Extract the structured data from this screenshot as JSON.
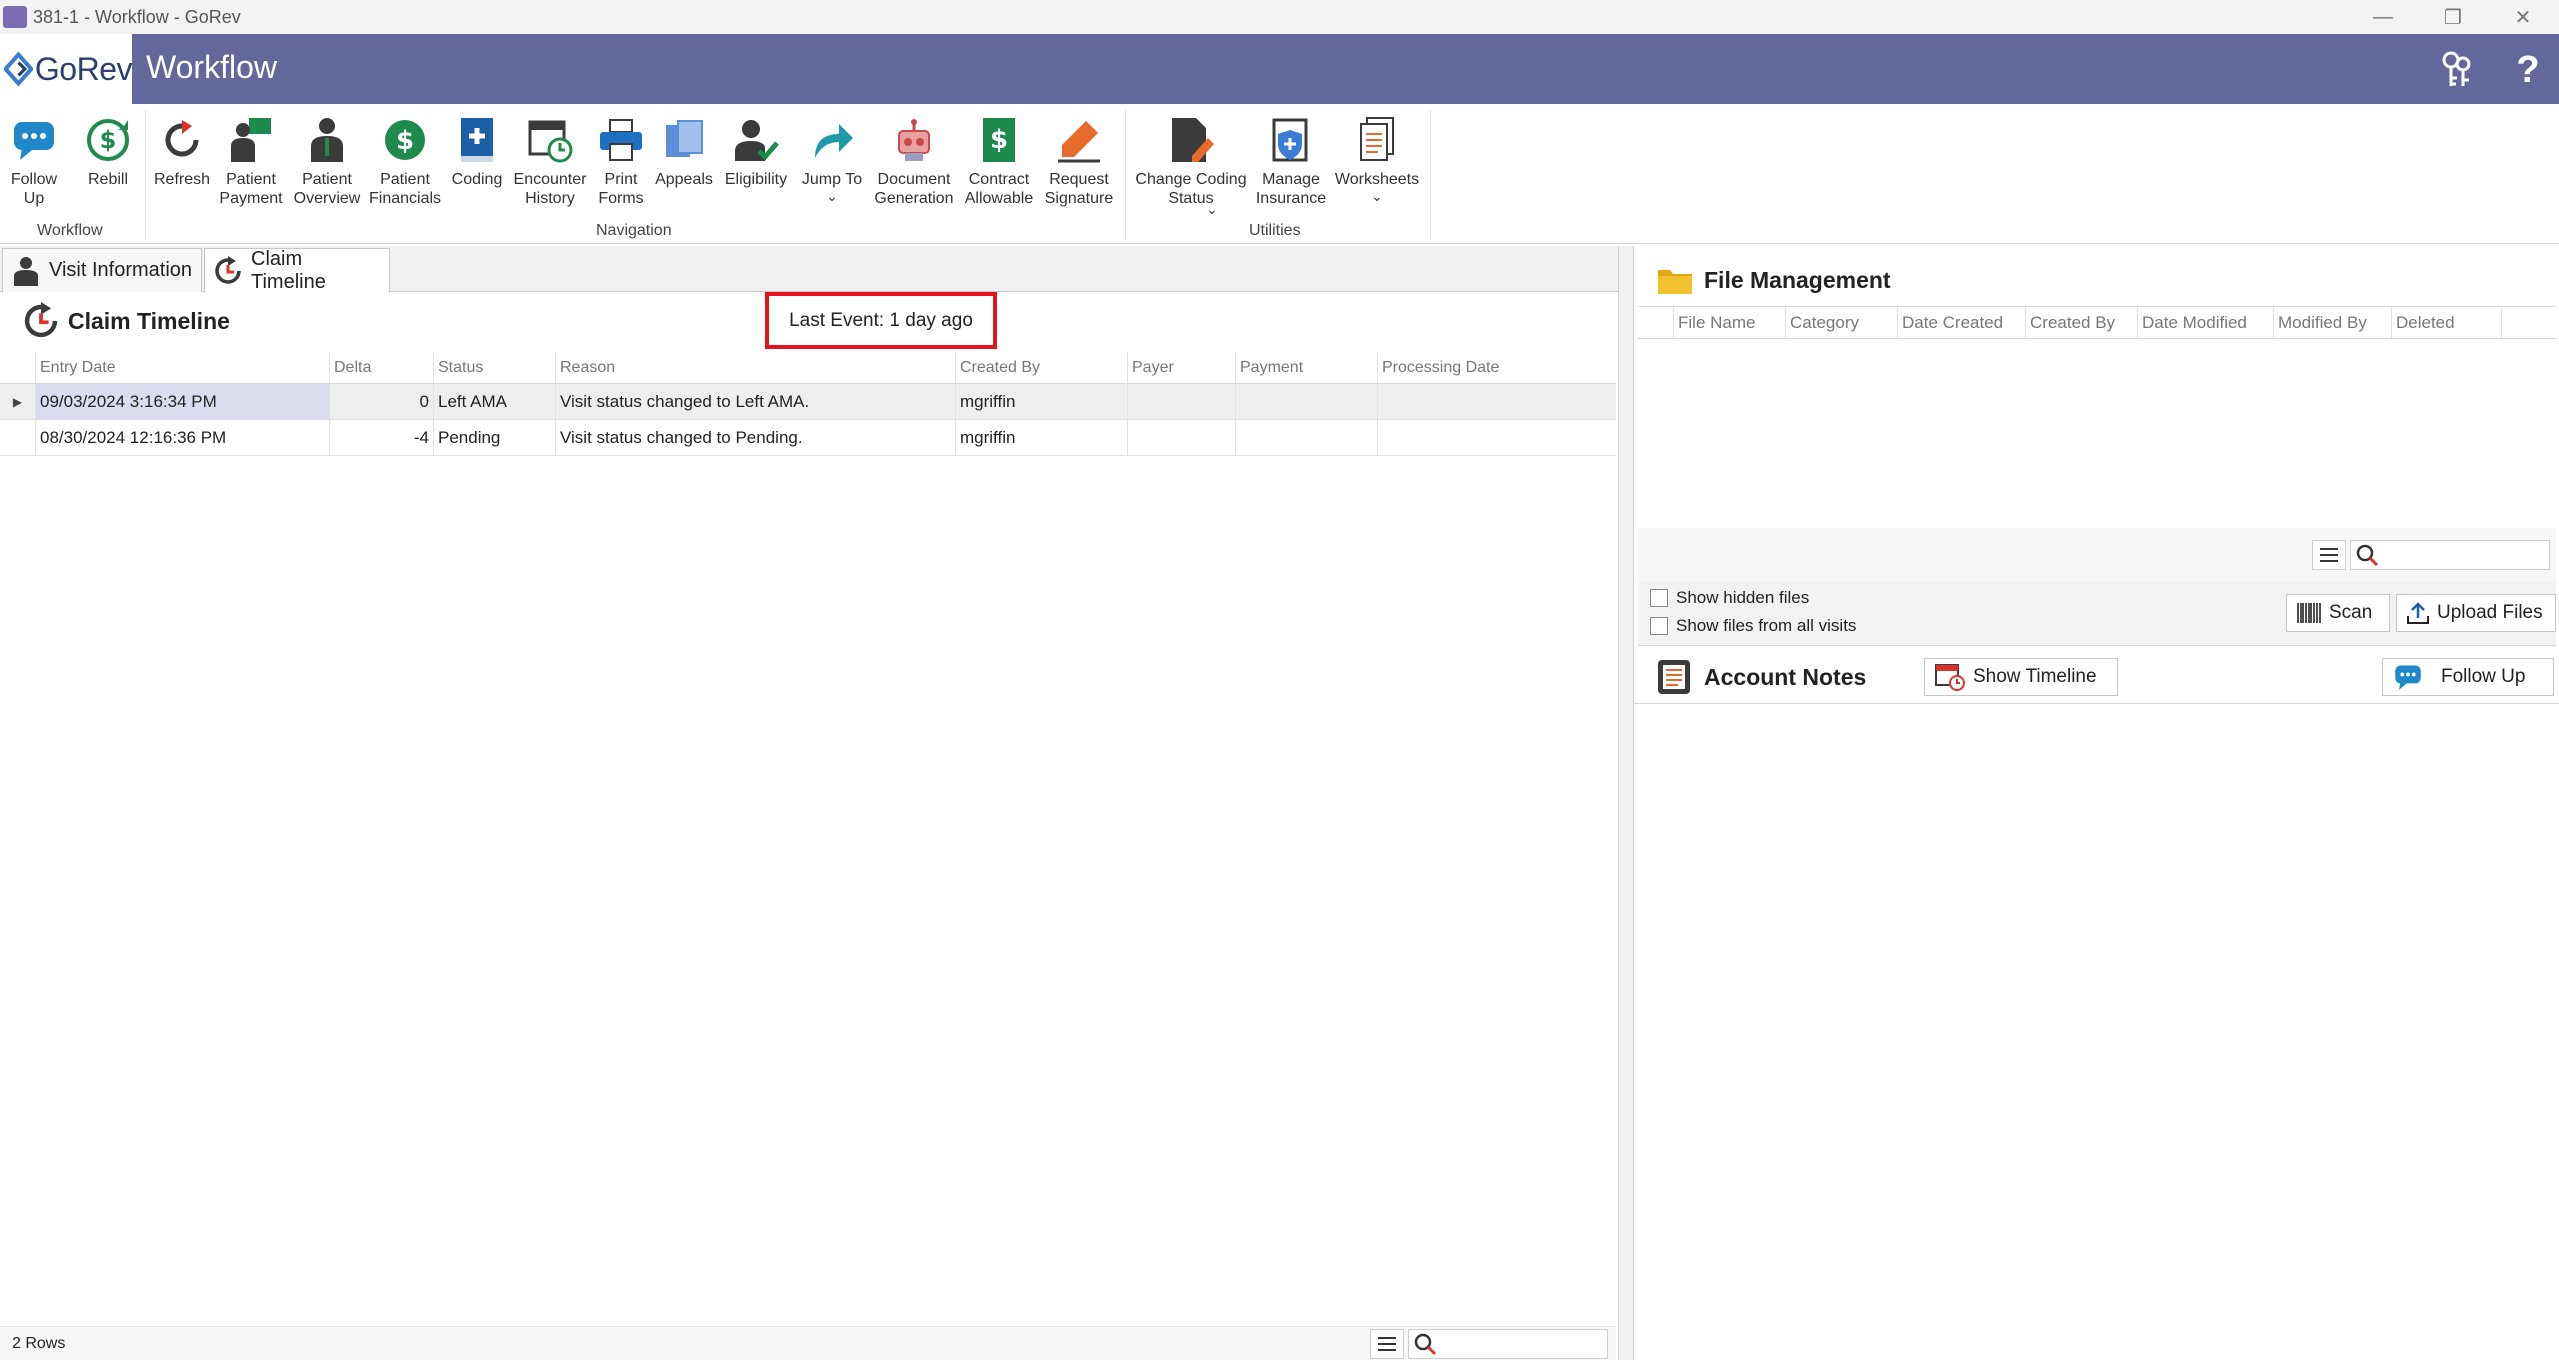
{
  "window": {
    "title": "381-1 - Workflow - GoRev",
    "controls": {
      "minimize": "—",
      "restore": "❐",
      "close": "✕"
    }
  },
  "header": {
    "logo_text": "GoRev",
    "title": "Workflow",
    "brand_color": "#64679b"
  },
  "ribbon": {
    "groups": [
      {
        "label": "Workflow"
      },
      {
        "label": "Navigation"
      },
      {
        "label": "Utilities"
      }
    ],
    "buttons": [
      {
        "label": "Follow\nUp",
        "icon": "chat-icon"
      },
      {
        "label": "Rebill",
        "icon": "rebill-dollar-icon"
      },
      {
        "label": "Refresh",
        "icon": "refresh-icon"
      },
      {
        "label": "Patient\nPayment",
        "icon": "patient-payment-icon"
      },
      {
        "label": "Patient\nOverview",
        "icon": "patient-overview-icon"
      },
      {
        "label": "Patient\nFinancials",
        "icon": "dollar-circle-icon"
      },
      {
        "label": "Coding",
        "icon": "medical-book-icon"
      },
      {
        "label": "Encounter\nHistory",
        "icon": "calendar-clock-icon"
      },
      {
        "label": "Print\nForms",
        "icon": "printer-icon"
      },
      {
        "label": "Appeals",
        "icon": "documents-icon"
      },
      {
        "label": "Eligibility",
        "icon": "user-check-icon"
      },
      {
        "label": "Jump To",
        "icon": "jump-arrow-icon"
      },
      {
        "label": "Document\nGeneration",
        "icon": "robot-icon"
      },
      {
        "label": "Contract\nAllowable",
        "icon": "dollar-document-icon"
      },
      {
        "label": "Request\nSignature",
        "icon": "pen-signature-icon"
      },
      {
        "label": "Change Coding\nStatus",
        "icon": "document-pen-icon"
      },
      {
        "label": "Manage\nInsurance",
        "icon": "insurance-shield-icon"
      },
      {
        "label": "Worksheets",
        "icon": "worksheets-icon"
      }
    ]
  },
  "left": {
    "tabs": [
      {
        "label": "Visit Information"
      },
      {
        "label": "Claim Timeline"
      }
    ],
    "section_title": "Claim Timeline",
    "last_event": "Last Event: 1 day ago",
    "columns": [
      "Entry Date",
      "Delta",
      "Status",
      "Reason",
      "Created By",
      "Payer",
      "Payment",
      "Processing Date"
    ],
    "rows": [
      [
        "09/03/2024 3:16:34 PM",
        "0",
        "Left AMA",
        "Visit status changed to Left AMA.",
        "mgriffin",
        "",
        "",
        ""
      ],
      [
        "08/30/2024 12:16:36 PM",
        "-4",
        "Pending",
        "Visit status changed to Pending.",
        "mgriffin",
        "",
        "",
        ""
      ]
    ],
    "row_count": "2 Rows",
    "highlight_color": "#e3131b"
  },
  "right": {
    "file_management": {
      "title": "File Management",
      "columns": [
        "File Name",
        "Category",
        "Date Created",
        "Created By",
        "Date Modified",
        "Modified By",
        "Deleted"
      ],
      "show_hidden_label": "Show hidden files",
      "show_all_visits_label": "Show files from all visits",
      "scan_label": "Scan",
      "upload_label": "Upload Files"
    },
    "account_notes": {
      "title": "Account Notes",
      "show_timeline_label": "Show Timeline",
      "follow_up_label": "Follow Up"
    }
  }
}
